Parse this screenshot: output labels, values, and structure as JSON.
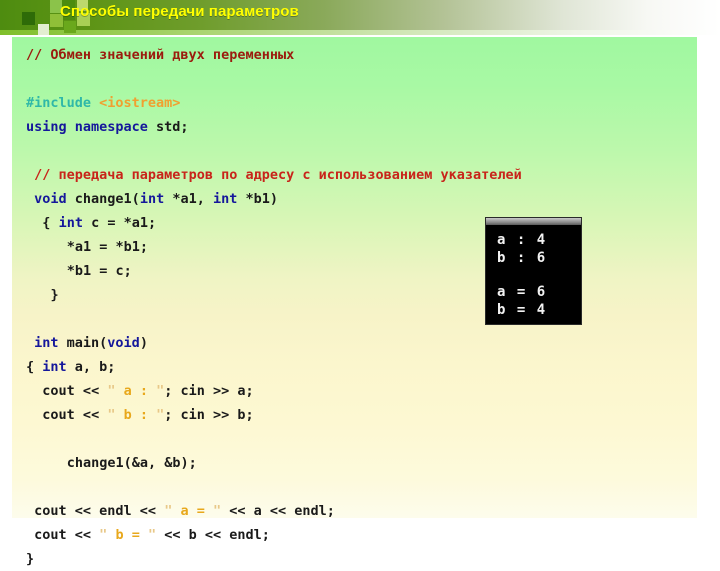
{
  "header": {
    "title": "Способы передачи параметров",
    "title_color": "#ffff00",
    "banner_start_color": "#4e8c10",
    "banner_end_color": "#ffffff",
    "decor_squares": [
      {
        "name": "square-dark-green",
        "color": "#2e6b08"
      },
      {
        "name": "square-light-green",
        "color": "#8bc34a"
      },
      {
        "name": "square-mid-green",
        "color": "#4b8c0e"
      },
      {
        "name": "square-pale-green",
        "color": "#bdd86e"
      },
      {
        "name": "square-olive-green",
        "color": "#8fbf38"
      },
      {
        "name": "square-grass-green",
        "color": "#6aa81c"
      },
      {
        "name": "square-soft-green",
        "color": "#a8cf55"
      },
      {
        "name": "square-white-green",
        "color": "#e3eed0"
      }
    ]
  },
  "code_panel": {
    "background_top_color": "#a0f8a0",
    "background_bottom_color": "#fdfcec",
    "language": "cpp",
    "lines": [
      {
        "id": "line-comment-swap",
        "indent": 0,
        "tokens": [
          {
            "text": "// Обмен значений двух переменных",
            "type": "comment"
          }
        ]
      },
      {
        "id": "line-blank-1",
        "indent": 0,
        "tokens": []
      },
      {
        "id": "line-include",
        "indent": 0,
        "tokens": [
          {
            "text": "#include ",
            "type": "preprocessor"
          },
          {
            "text": "<iostream>",
            "type": "include-path"
          }
        ]
      },
      {
        "id": "line-using-namespace",
        "indent": 0,
        "tokens": [
          {
            "text": "using namespace ",
            "type": "keyword"
          },
          {
            "text": "std;",
            "type": "plain"
          }
        ]
      },
      {
        "id": "line-blank-2",
        "indent": 0,
        "tokens": []
      },
      {
        "id": "line-comment-pointers",
        "indent": 1,
        "tokens": [
          {
            "text": "// передача параметров по адресу с использованием указателей",
            "type": "comment-bright"
          }
        ]
      },
      {
        "id": "line-change1-signature",
        "indent": 1,
        "tokens": [
          {
            "text": "void ",
            "type": "keyword"
          },
          {
            "text": "change1(",
            "type": "plain"
          },
          {
            "text": "int ",
            "type": "keyword"
          },
          {
            "text": "*a1, ",
            "type": "plain"
          },
          {
            "text": "int ",
            "type": "keyword"
          },
          {
            "text": "*b1)",
            "type": "plain"
          }
        ]
      },
      {
        "id": "line-open-brace-int-c",
        "indent": 2,
        "tokens": [
          {
            "text": "{ ",
            "type": "plain"
          },
          {
            "text": "int ",
            "type": "keyword"
          },
          {
            "text": "c = *a1;",
            "type": "plain"
          }
        ]
      },
      {
        "id": "line-a1-assign",
        "indent": 5,
        "tokens": [
          {
            "text": "*a1 = *b1;",
            "type": "plain"
          }
        ]
      },
      {
        "id": "line-b1-assign",
        "indent": 5,
        "tokens": [
          {
            "text": "*b1 = c;",
            "type": "plain"
          }
        ]
      },
      {
        "id": "line-close-brace-change1",
        "indent": 3,
        "tokens": [
          {
            "text": "}",
            "type": "plain"
          }
        ]
      },
      {
        "id": "line-blank-3",
        "indent": 0,
        "tokens": []
      },
      {
        "id": "line-main-signature",
        "indent": 1,
        "tokens": [
          {
            "text": "int ",
            "type": "keyword"
          },
          {
            "text": "main(",
            "type": "plain"
          },
          {
            "text": "void",
            "type": "keyword"
          },
          {
            "text": ")",
            "type": "plain"
          }
        ]
      },
      {
        "id": "line-main-open-brace",
        "indent": 0,
        "tokens": [
          {
            "text": "{ ",
            "type": "plain"
          },
          {
            "text": "int ",
            "type": "keyword"
          },
          {
            "text": "a, b;",
            "type": "plain"
          }
        ]
      },
      {
        "id": "line-cout-prompt-a",
        "indent": 2,
        "tokens": [
          {
            "text": "cout << ",
            "type": "plain"
          },
          {
            "text": "\"",
            "type": "string"
          },
          {
            "text": " a : ",
            "type": "string-inner"
          },
          {
            "text": "\"",
            "type": "string"
          },
          {
            "text": "; cin >> a;",
            "type": "plain"
          }
        ]
      },
      {
        "id": "line-cout-prompt-b",
        "indent": 2,
        "tokens": [
          {
            "text": "cout << ",
            "type": "plain"
          },
          {
            "text": "\"",
            "type": "string"
          },
          {
            "text": " b : ",
            "type": "string-inner"
          },
          {
            "text": "\"",
            "type": "string"
          },
          {
            "text": "; cin >> b;",
            "type": "plain"
          }
        ]
      },
      {
        "id": "line-blank-4",
        "indent": 0,
        "tokens": []
      },
      {
        "id": "line-call-change1",
        "indent": 5,
        "tokens": [
          {
            "text": "change1(&a, &b);",
            "type": "plain"
          }
        ]
      },
      {
        "id": "line-blank-5",
        "indent": 0,
        "tokens": []
      },
      {
        "id": "line-cout-result-a",
        "indent": 1,
        "tokens": [
          {
            "text": "cout << endl << ",
            "type": "plain"
          },
          {
            "text": "\"",
            "type": "string"
          },
          {
            "text": " a = ",
            "type": "string-inner"
          },
          {
            "text": "\"",
            "type": "string"
          },
          {
            "text": " << a << endl;",
            "type": "plain"
          }
        ]
      },
      {
        "id": "line-cout-result-b",
        "indent": 1,
        "tokens": [
          {
            "text": "cout << ",
            "type": "plain"
          },
          {
            "text": "\"",
            "type": "string"
          },
          {
            "text": " b = ",
            "type": "string-inner"
          },
          {
            "text": "\"",
            "type": "string"
          },
          {
            "text": " << b << endl;",
            "type": "plain"
          }
        ]
      },
      {
        "id": "line-main-close-brace",
        "indent": 0,
        "tokens": [
          {
            "text": "}",
            "type": "plain"
          }
        ]
      }
    ]
  },
  "console": {
    "background_color": "#000000",
    "text_color": "#f2f2f2",
    "lines": [
      "a : 4",
      "b : 6",
      "",
      "a = 6",
      "b = 4"
    ]
  }
}
